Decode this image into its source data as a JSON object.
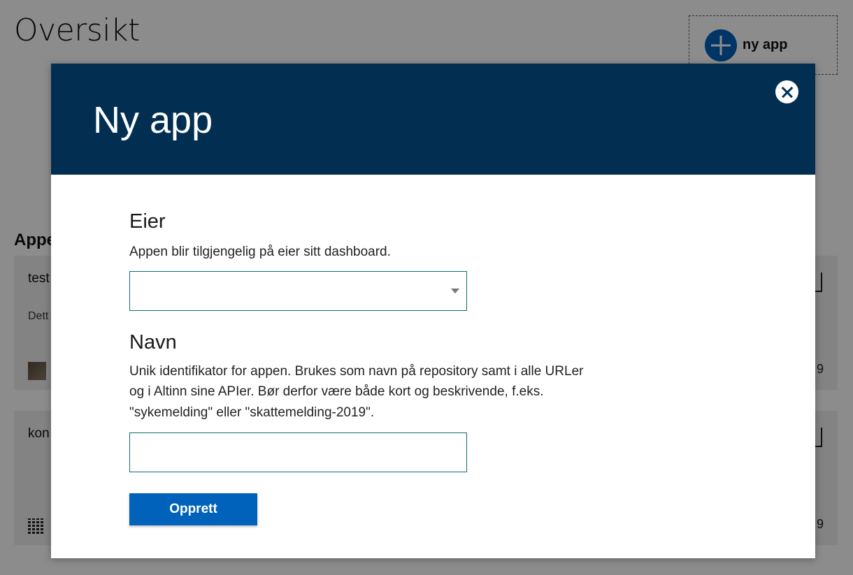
{
  "page": {
    "title": "Oversikt",
    "new_app_label": "ny app",
    "section_heading": "Appe",
    "cards": [
      {
        "name": "test",
        "description": "Dett",
        "date_fragment": "9"
      },
      {
        "name": "kon",
        "description": "",
        "date_fragment": "9"
      }
    ]
  },
  "modal": {
    "title": "Ny app",
    "owner": {
      "title": "Eier",
      "description": "Appen blir tilgjengelig på eier sitt dashboard.",
      "selected": ""
    },
    "name": {
      "title": "Navn",
      "description": "Unik identifikator for appen. Brukes som navn på repository samt i alle URLer og i Altinn sine APIer. Bør derfor være både kort og beskrivende, f.eks. \"sykemelding\" eller \"skattemelding-2019\".",
      "value": "",
      "placeholder": ""
    },
    "create_label": "Opprett"
  },
  "colors": {
    "header_bg": "#022f51",
    "primary_button": "#0062ba",
    "input_border": "#0b6f6a"
  },
  "icons": {
    "close": "close-icon",
    "add": "plus-circle-icon",
    "caret": "caret-down-icon"
  }
}
